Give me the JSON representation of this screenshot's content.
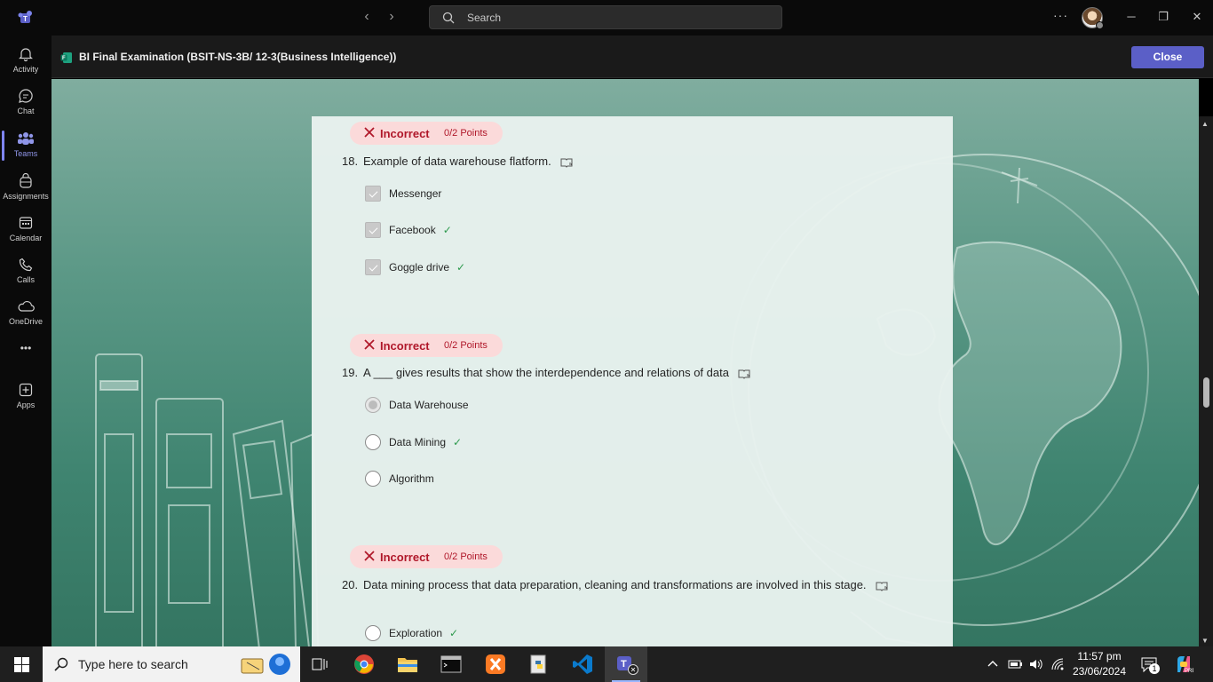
{
  "titlebar": {
    "search_placeholder": "Search",
    "back_icon": "chevron-left-icon",
    "forward_icon": "chevron-right-icon",
    "more_label": "···",
    "window_controls": {
      "minimize": "─",
      "restore": "❐",
      "close": "✕"
    }
  },
  "rail": {
    "items": [
      {
        "label": "Activity",
        "icon": "bell-icon"
      },
      {
        "label": "Chat",
        "icon": "chat-icon"
      },
      {
        "label": "Teams",
        "icon": "teams-icon"
      },
      {
        "label": "Assignments",
        "icon": "backpack-icon"
      },
      {
        "label": "Calendar",
        "icon": "calendar-icon"
      },
      {
        "label": "Calls",
        "icon": "phone-icon"
      },
      {
        "label": "OneDrive",
        "icon": "cloud-icon"
      },
      {
        "label": "Apps",
        "icon": "plus-box-icon"
      }
    ],
    "more_label": "•••",
    "active": "Teams"
  },
  "header": {
    "title": "BI Final Examination (BSIT-NS-3B/ 12-3(Business Intelligence))",
    "close_label": "Close"
  },
  "questions": [
    {
      "status": "Incorrect",
      "points": "0/2 Points",
      "number": "18.",
      "text": "Example of data warehouse flatform.",
      "type": "checkbox",
      "options": [
        {
          "label": "Messenger",
          "checked": true,
          "correct": false
        },
        {
          "label": "Facebook",
          "checked": true,
          "correct": true
        },
        {
          "label": "Goggle drive",
          "checked": true,
          "correct": true
        }
      ]
    },
    {
      "status": "Incorrect",
      "points": "0/2 Points",
      "number": "19.",
      "text": "A ___ gives results that show the interdependence and relations of data",
      "type": "radio",
      "options": [
        {
          "label": "Data Warehouse",
          "selected": true,
          "correct": false
        },
        {
          "label": "Data Mining",
          "selected": false,
          "correct": true
        },
        {
          "label": "Algorithm",
          "selected": false,
          "correct": false
        }
      ]
    },
    {
      "status": "Incorrect",
      "points": "0/2 Points",
      "number": "20.",
      "text": "Data mining process that data preparation, cleaning and transformations   are involved in this stage.",
      "type": "radio",
      "options": [
        {
          "label": "Exploration",
          "selected": false,
          "correct": true
        }
      ]
    }
  ],
  "correct_mark": "✓",
  "taskbar": {
    "search_placeholder": "Type here to search",
    "apps": [
      "task-view",
      "chrome",
      "file-explorer",
      "terminal",
      "xampp",
      "python",
      "vscode",
      "teams"
    ],
    "time": "11:57 pm",
    "date": "23/06/2024",
    "notification_count": "1"
  },
  "colors": {
    "accent": "#5b5fc7",
    "incorrect_bg": "#fbdada",
    "incorrect_text": "#b0182a",
    "correct_check": "#2e9a4e",
    "chalkboard": "#4a8c78"
  }
}
